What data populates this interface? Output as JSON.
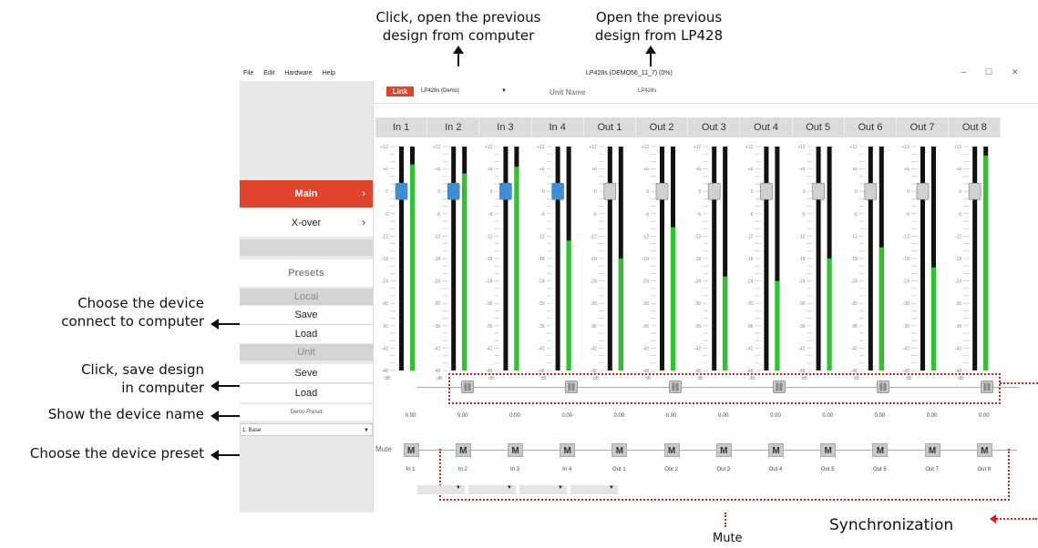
{
  "annotations": {
    "open_computer": "Click, open the previous\ndesign from computer",
    "open_device": "Open the previous\ndesign from LP428",
    "choose_device": "Choose the device\nconnect to computer",
    "save_computer": "Click, save design\nin computer",
    "show_name": "Show the device name",
    "choose_preset": "Choose the device preset",
    "synchronization": "Synchronization",
    "mute": "Mute"
  },
  "window": {
    "title": "LP428s (DEMO56_11_7) (0%)",
    "menu": [
      "File",
      "Edit",
      "Hardware",
      "Help"
    ],
    "controls": {
      "min": "–",
      "max": "☐",
      "close": "✕"
    }
  },
  "topbar": {
    "link_label": "Link",
    "device_select": "LP428s (Demo)",
    "unit_name_label": "Unit Name",
    "unit_name_value": "LP428s"
  },
  "sidebar": {
    "main": "Main",
    "xover": "X-over",
    "presets": "Presets",
    "local": "Local",
    "local_save": "Save",
    "local_load": "Load",
    "unit": "Unit",
    "unit_save": "Seve",
    "unit_load": "Load",
    "demo_preset": "Demo Preset",
    "preset_select": "1: Base"
  },
  "channels": {
    "headers": [
      "In 1",
      "In 2",
      "In 3",
      "In 4",
      "Out 1",
      "Out 2",
      "Out 3",
      "Out 4",
      "Out 5",
      "Out 6",
      "Out 7",
      "Out 8"
    ],
    "names": [
      "In 1",
      "In 2",
      "In 3",
      "In 4",
      "Out 1",
      "Out 2",
      "Out 3",
      "Out 4",
      "Out 5",
      "Out 6",
      "Out 7",
      "Out 8"
    ],
    "gain_values": [
      "0.00",
      "0.00",
      "0.00",
      "0.00",
      "0.00",
      "0.00",
      "0.00",
      "0.00",
      "0.00",
      "0.00",
      "0.00",
      "0.00"
    ],
    "meter_levels": [
      0.92,
      0.88,
      0.91,
      0.58,
      0.5,
      0.64,
      0.42,
      0.4,
      0.5,
      0.55,
      0.46,
      0.96
    ],
    "scale": [
      "+12",
      "+6",
      "0",
      "-6",
      "-12",
      "-18",
      "-24",
      "-30",
      "-36",
      "-42",
      "-48"
    ],
    "scale_unit": "dB",
    "mute_label": "M",
    "link_label": "Link",
    "mute_row_label": "Mute"
  },
  "colors": {
    "accent_red": "#e0442c",
    "meter_green": "#2ec42e",
    "fader_in": "#3a8fd6",
    "fader_out": "#d0d0d0",
    "dotted_red": "#d62020"
  }
}
